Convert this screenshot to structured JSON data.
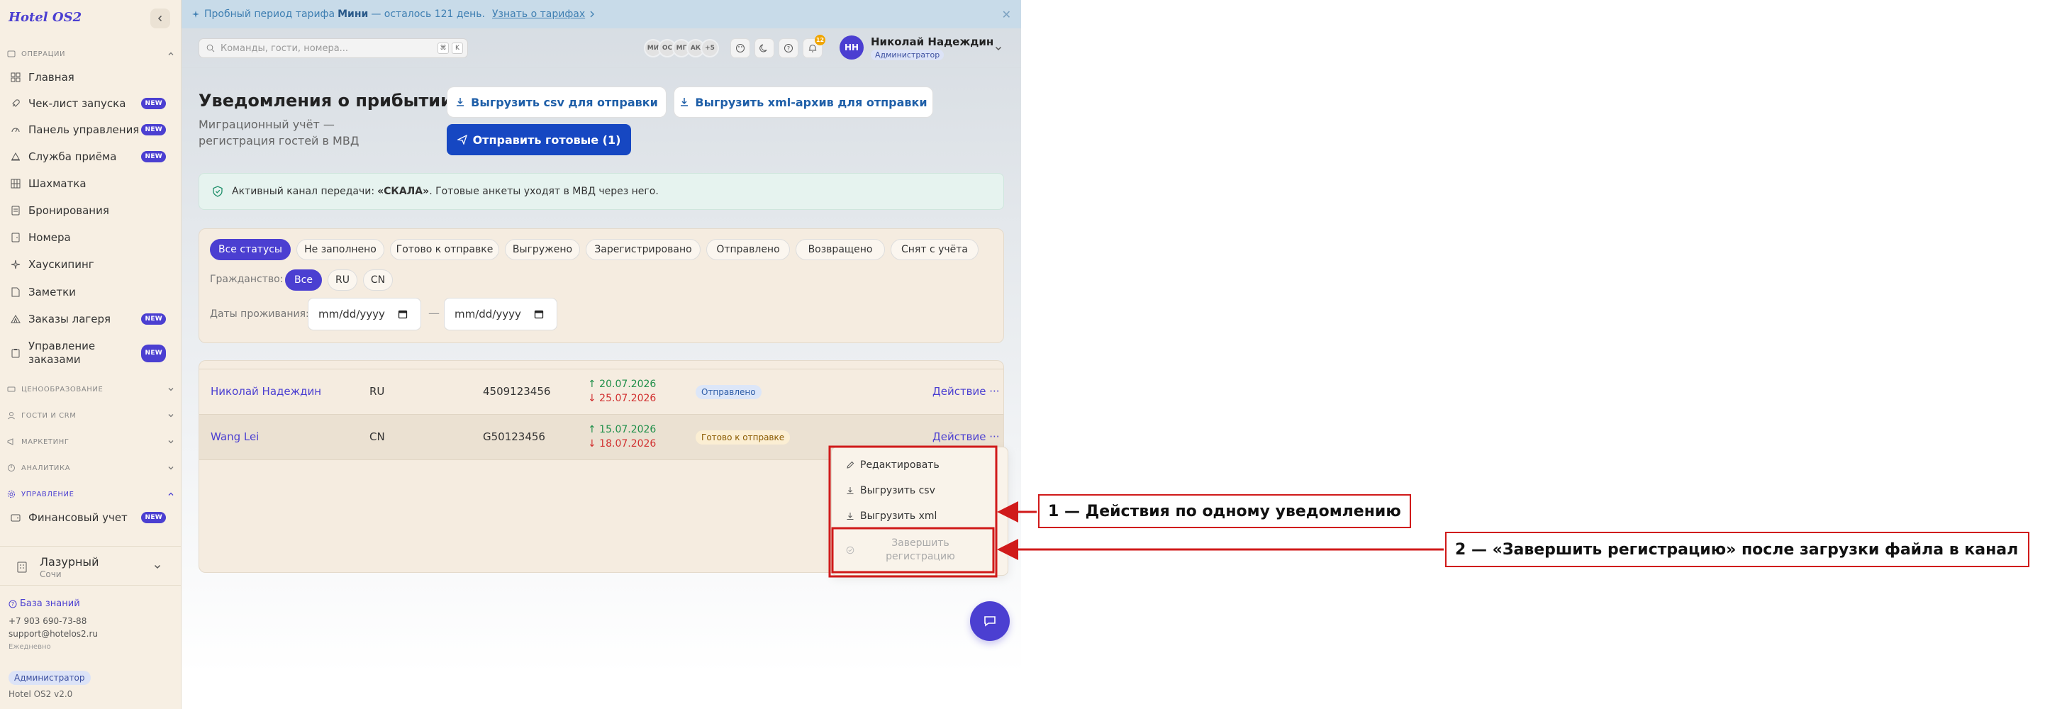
{
  "sidebar": {
    "brand": "Hotel OS2",
    "sections": [
      {
        "label": "ОПЕРАЦИИ"
      },
      {
        "label": "ЦЕНООБРАЗОВАНИЕ"
      },
      {
        "label": "ГОСТИ И CRM"
      },
      {
        "label": "МАРКЕТИНГ"
      },
      {
        "label": "АНАЛИТИКА"
      },
      {
        "label": "УПРАВЛЕНИЕ"
      }
    ],
    "items": [
      {
        "label": "Главная",
        "icon": "dashboard-icon"
      },
      {
        "label": "Чек-лист запуска",
        "icon": "rocket-icon",
        "badge": "NEW"
      },
      {
        "label": "Панель управления",
        "icon": "gauge-icon",
        "badge": "NEW"
      },
      {
        "label": "Служба приёма",
        "icon": "bell-desk-icon",
        "badge": "NEW"
      },
      {
        "label": "Шахматка",
        "icon": "grid-icon"
      },
      {
        "label": "Бронирования",
        "icon": "document-icon"
      },
      {
        "label": "Номера",
        "icon": "room-icon"
      },
      {
        "label": "Хаускипинг",
        "icon": "sparkle-icon"
      },
      {
        "label": "Заметки",
        "icon": "note-icon"
      },
      {
        "label": "Заказы лагеря",
        "icon": "tent-icon",
        "badge": "NEW"
      },
      {
        "label": "Управление заказами",
        "icon": "clipboard-icon",
        "badge": "NEW"
      },
      {
        "label": "Финансовый учет",
        "icon": "wallet-icon",
        "badge": "NEW"
      }
    ],
    "hotel": {
      "name": "Лазурный",
      "city": "Сочи"
    },
    "knowledge_base": "База знаний",
    "phone": "+7 903 690-73-88",
    "email": "support@hotelos2.ru",
    "schedule": "Ежедневно",
    "role": "Администратор",
    "version": "Hotel OS2 v2.0"
  },
  "trial": {
    "prefix": "Пробный период тарифа",
    "plan": "Мини",
    "suffix": "— осталось 121 день.",
    "link": "Узнать о тарифах"
  },
  "topbar": {
    "search_placeholder": "Команды, гости, номера...",
    "kbd1": "⌘",
    "kbd2": "K",
    "avatars": [
      "МИ",
      "ОС",
      "МГ",
      "АК",
      "+5"
    ],
    "notifications_count": "12",
    "user_initials": "НН",
    "user_name": "Николай Надеждин",
    "user_role": "Администратор"
  },
  "page": {
    "title": "Уведомления о прибытии",
    "subtitle": "Миграционный учёт — регистрация гостей в МВД",
    "btn_csv": "Выгрузить csv для отправки",
    "btn_xml": "Выгрузить xml-архив для отправки",
    "btn_send": "Отправить готовые (1)"
  },
  "channel": {
    "prefix": "Активный канал передачи:",
    "name": "«СКАЛА»",
    "suffix": ". Готовые анкеты уходят в МВД через него."
  },
  "filters": {
    "statuses": [
      "Все статусы",
      "Не заполнено",
      "Готово к отправке",
      "Выгружено",
      "Зарегистрировано",
      "Отправлено",
      "Возвращено",
      "Снят с учёта"
    ],
    "citizenship_label": "Гражданство:",
    "citizenship": [
      "Все",
      "RU",
      "CN"
    ],
    "dates_label": "Даты проживания:",
    "date_from": "mm/dd/yyyy",
    "date_to": "mm/dd/yyyy",
    "date_sep": "—"
  },
  "table": {
    "rows": [
      {
        "name": "Николай Надеждин",
        "country": "RU",
        "document": "4509123456",
        "arrival": "↑ 20.07.2026",
        "departure": "↓ 25.07.2026",
        "status": "Отправлено",
        "action": "Действие ···"
      },
      {
        "name": "Wang Lei",
        "country": "CN",
        "document": "G50123456",
        "arrival": "↑ 15.07.2026",
        "departure": "↓ 18.07.2026",
        "status": "Готово к отправке",
        "action": "Действие ···"
      }
    ]
  },
  "menu": {
    "edit": "Редактировать",
    "csv": "Выгрузить csv",
    "xml": "Выгрузить xml",
    "finish": "Завершить регистрацию"
  },
  "annotations": {
    "one": "1 — Действия по одному уведомлению",
    "two": "2 — «Завершить регистрацию» после загрузки файла в канал"
  },
  "colors": {
    "accent": "#4b3fd1",
    "send_button": "#1647c2",
    "annotation": "#d01a1a"
  }
}
